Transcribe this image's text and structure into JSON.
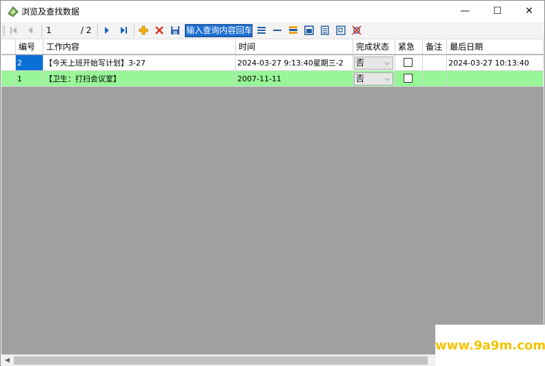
{
  "window": {
    "title": "浏览及查找数据",
    "controls": {
      "minimize": "—",
      "maximize": "☐",
      "close": "✕"
    }
  },
  "toolbar": {
    "current_page": "1",
    "page_total": "/ 2",
    "search_text": "输入查询内容回车",
    "icons": [
      "first-page-icon",
      "prev-page-icon",
      "next-page-icon",
      "last-page-icon",
      "add-icon",
      "delete-icon",
      "save-icon",
      "align-all-icon",
      "align-line-icon",
      "color-bars-icon",
      "window-icon",
      "document-icon",
      "copy-icon",
      "clear-filter-icon"
    ]
  },
  "colors": {
    "selected": "#0a6fd6",
    "green_row": "#98f598",
    "grid_bg": "#a0a0a0",
    "search_bg": "#1f6fd1",
    "watermark": "#f2c400"
  },
  "table": {
    "columns": [
      "编号",
      "工作内容",
      "时间",
      "完成状态",
      "紧急",
      "备注",
      "最后日期"
    ],
    "rows": [
      {
        "id": "2",
        "content": "【今天上班开始写计划】3-27",
        "time": "2024-03-27 9:13:40星期三-2",
        "status": "否",
        "urgent": false,
        "note": "",
        "last": "2024-03-27 10:13:40"
      },
      {
        "id": "1",
        "content": "【卫生：打扫会议室】",
        "time": "2007-11-11",
        "status": "否",
        "urgent": false,
        "note": "",
        "last": ""
      }
    ]
  },
  "watermark": "www.9a9m.com"
}
